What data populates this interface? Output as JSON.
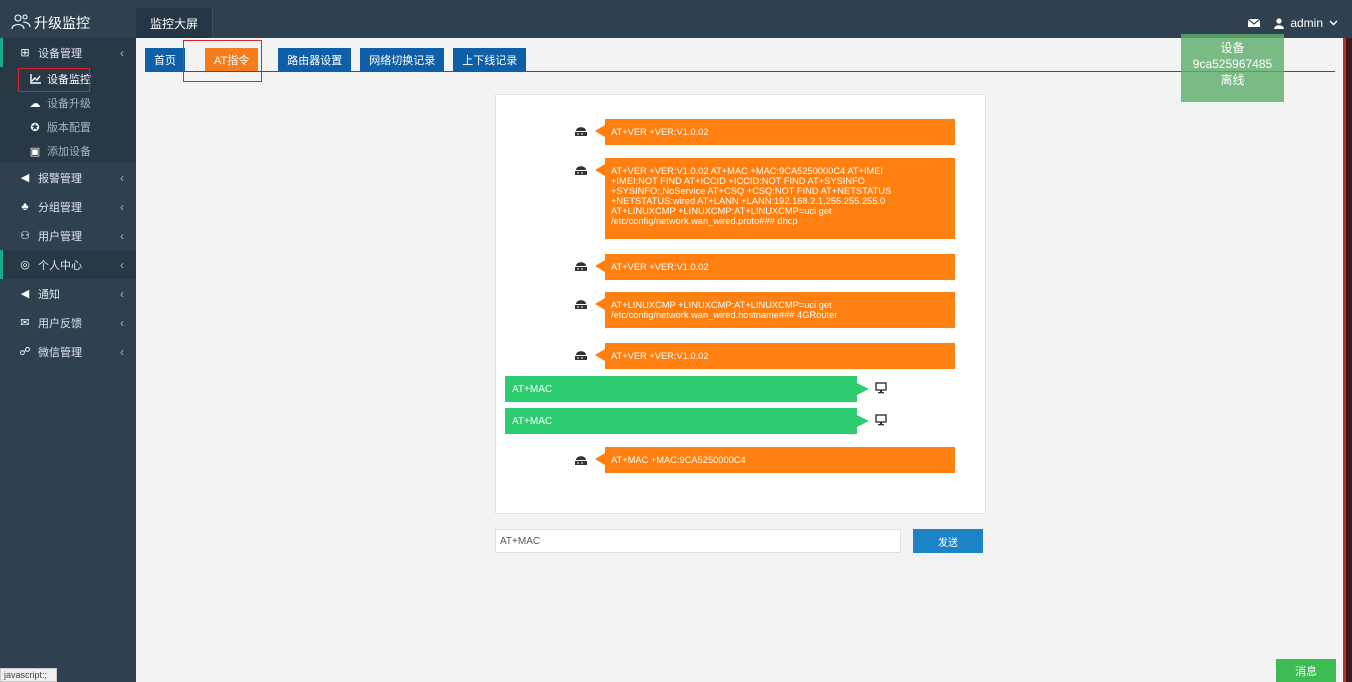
{
  "app": {
    "title": "升级监控",
    "logo_icon": "people-icon"
  },
  "topnav": {
    "tab": "监控大屏",
    "user": "admin",
    "mail_icon": "envelope-icon",
    "user_icon": "user-icon"
  },
  "sidebar": {
    "items": [
      {
        "label": "设备管理",
        "icon": "grid-icon"
      },
      {
        "label": "报警管理",
        "icon": "megaphone-icon"
      },
      {
        "label": "分组管理",
        "icon": "sitemap-icon"
      },
      {
        "label": "用户管理",
        "icon": "users-icon"
      },
      {
        "label": "个人中心",
        "icon": "user-circle-icon"
      },
      {
        "label": "通知",
        "icon": "megaphone-icon"
      },
      {
        "label": "用户反馈",
        "icon": "envelope-icon"
      },
      {
        "label": "微信管理",
        "icon": "wechat-icon"
      }
    ],
    "subitems": [
      {
        "label": "设备监控",
        "icon": "line-chart-icon"
      },
      {
        "label": "设备升级",
        "icon": "cloud-upload-icon"
      },
      {
        "label": "版本配置",
        "icon": "compass-icon"
      },
      {
        "label": "添加设备",
        "icon": "id-card-icon"
      }
    ]
  },
  "tabs": [
    "首页",
    "AT指令",
    "路由器设置",
    "网络切换记录",
    "上下线记录"
  ],
  "chat": {
    "messages": [
      {
        "from": "device",
        "text": "AT+VER +VER:V1.0.02"
      },
      {
        "from": "device",
        "lines": [
          "AT+VER +VER:V1.0.02 AT+MAC +MAC:9CA5250000C4 AT+IMEI",
          "+IMEI:NOT FIND AT+ICCID +ICCID:NOT FIND AT+SYSINFO",
          "+SYSINFO:,NoService AT+CSQ +CSQ:NOT FIND AT+NETSTATUS",
          "+NETSTATUS:wired AT+LANN +LANN:192.168.2.1,255.255.255.0",
          "AT+LINUXCMP +LINUXCMP:AT+LINUXCMP=uci get",
          "/etc/config/network.wan_wired.proto### dhcp"
        ]
      },
      {
        "from": "device",
        "text": "AT+VER +VER:V1.0.02"
      },
      {
        "from": "device",
        "lines": [
          "AT+LINUXCMP +LINUXCMP:AT+LINUXCMP=uci get",
          "/etc/config/network.wan_wired.hostname### 4GRouter"
        ]
      },
      {
        "from": "device",
        "text": "AT+VER +VER:V1.0.02"
      },
      {
        "from": "user",
        "text": "AT+MAC"
      },
      {
        "from": "user",
        "text": "AT+MAC"
      },
      {
        "from": "device",
        "text": "AT+MAC +MAC:9CA5250000C4"
      }
    ],
    "input_value": "AT+MAC",
    "send_label": "发送"
  },
  "toast": {
    "line1": "设备",
    "line2": "9ca525967485",
    "line3": "离线"
  },
  "message_button": "消息",
  "status_bar": "javascript:;",
  "colors": {
    "sidebar": "#2f4050",
    "tab": "#0e5ea8",
    "active_tab": "#f57c1f",
    "device_bubble": "#ff7f11",
    "user_bubble": "#2ecc71",
    "send": "#1c84c6"
  }
}
